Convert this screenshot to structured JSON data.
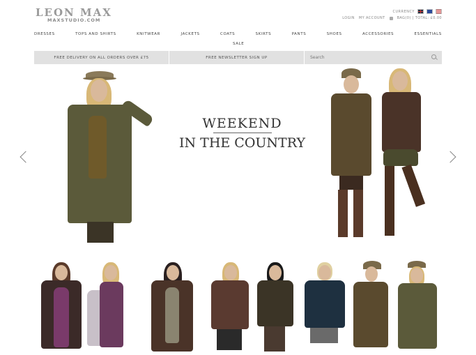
{
  "brand": {
    "name": "LEON MAX",
    "sub": "MAXSTUDIO.COM"
  },
  "header": {
    "currency_label": "CURRENCY",
    "login": "LOGIN",
    "account": "MY ACCOUNT",
    "bag": "BAG(0) | TOTAL: £0.00"
  },
  "nav": {
    "items": [
      "DRESSES",
      "TOPS AND SHIRTS",
      "KNITWEAR",
      "JACKETS",
      "COATS",
      "SKIRTS",
      "PANTS",
      "SHOES",
      "ACCESSORIES",
      "ESSENTIALS"
    ],
    "sale": "SALE"
  },
  "infobar": {
    "delivery": "FREE DELIVERY ON ALL ORDERS OVER £75",
    "newsletter": "FREE NEWSLETTER SIGN UP",
    "search_placeholder": "Search"
  },
  "hero": {
    "line1": "WEEKEND",
    "line2": "IN THE COUNTRY"
  },
  "colors": {
    "nav_bar": "#e1e1e1",
    "brand": "#9a9a9a",
    "coat_olive": "#5b5a3a",
    "coat_brown": "#4a3328",
    "plum": "#6b3a5e"
  }
}
